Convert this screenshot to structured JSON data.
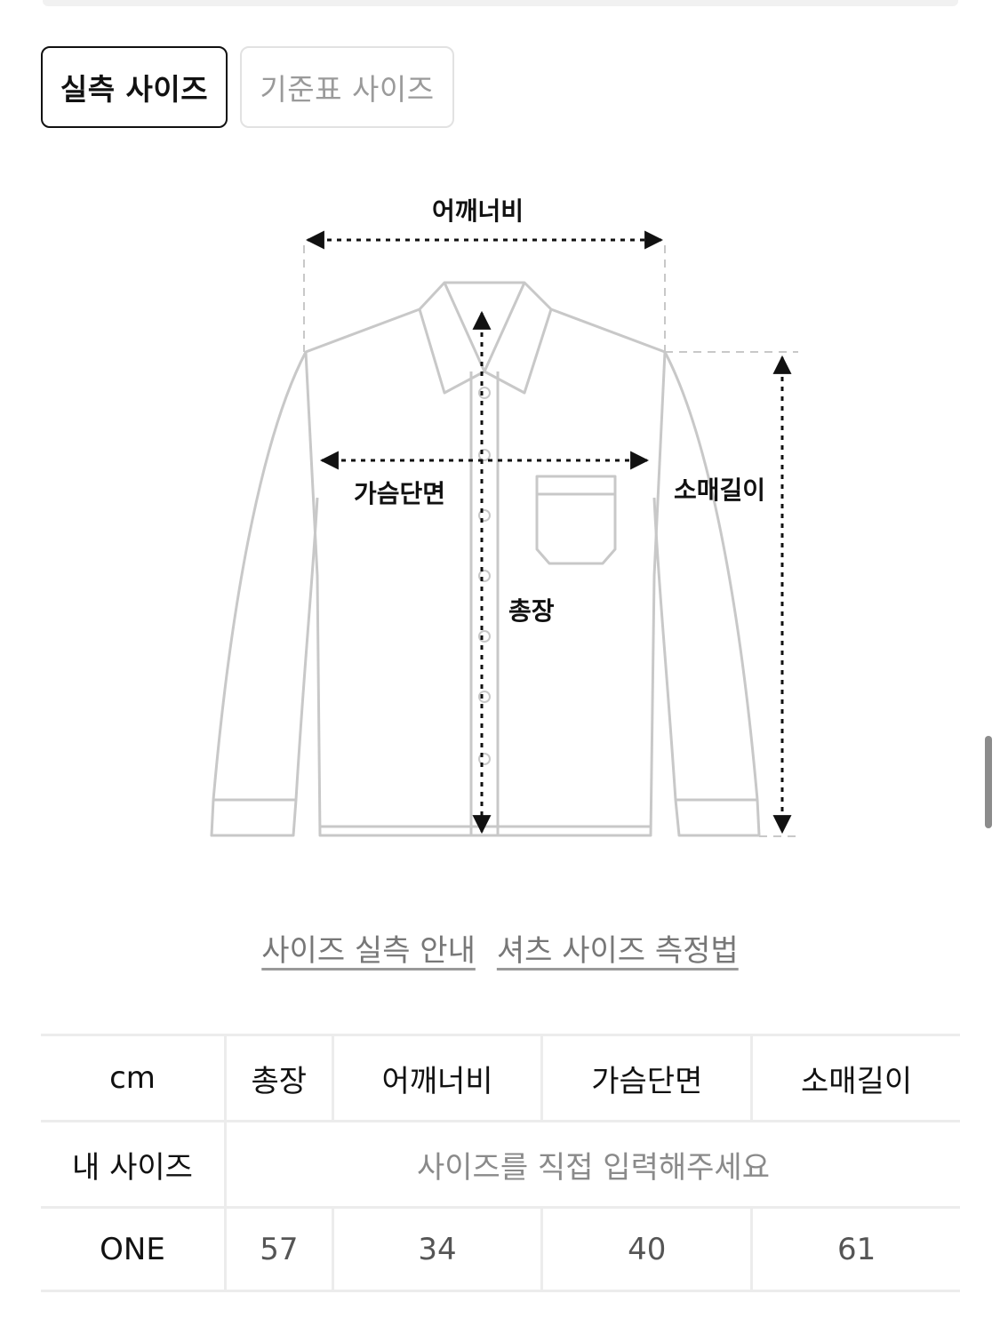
{
  "tabs": {
    "active_label": "실측 사이즈",
    "inactive_label": "기준표 사이즈"
  },
  "diagram": {
    "shoulder_label": "어깨너비",
    "chest_label": "가슴단면",
    "length_label": "총장",
    "sleeve_label": "소매길이"
  },
  "links": {
    "guide": "사이즈 실측 안내",
    "measure": "셔츠 사이즈 측정법"
  },
  "table": {
    "unit": "cm",
    "headers": [
      "총장",
      "어깨너비",
      "가슴단면",
      "소매길이"
    ],
    "my_size_label": "내 사이즈",
    "my_size_placeholder": "사이즈를 직접 입력해주세요",
    "rows": [
      {
        "size": "ONE",
        "values": [
          "57",
          "34",
          "40",
          "61"
        ]
      }
    ]
  }
}
